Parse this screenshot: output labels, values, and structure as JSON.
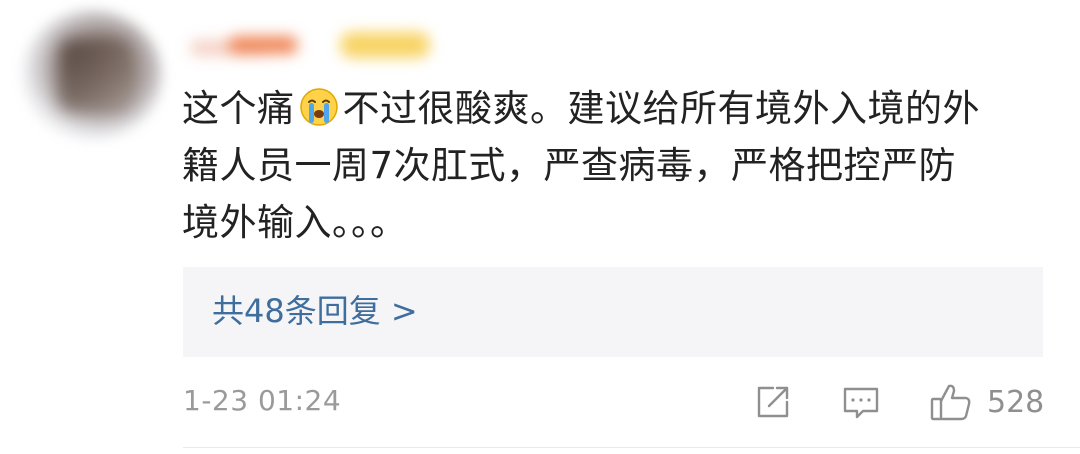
{
  "comment": {
    "line1_before_emoji": "这个痛",
    "emoji": "crying-face-icon",
    "line1_after_emoji": "不过很酸爽。建议给所有境外入境的外",
    "line2": "籍人员一周7次肛式，严查病毒，严格把控严防",
    "line3": "境外输入。。。"
  },
  "replies": {
    "label": "共48条回复 >"
  },
  "footer": {
    "timestamp": "1-23 01:24",
    "like_count": "528"
  },
  "colors": {
    "link": "#3f6e9e",
    "text": "#222222",
    "muted": "#9a9a9a",
    "reply_bg": "#f5f5f7"
  }
}
